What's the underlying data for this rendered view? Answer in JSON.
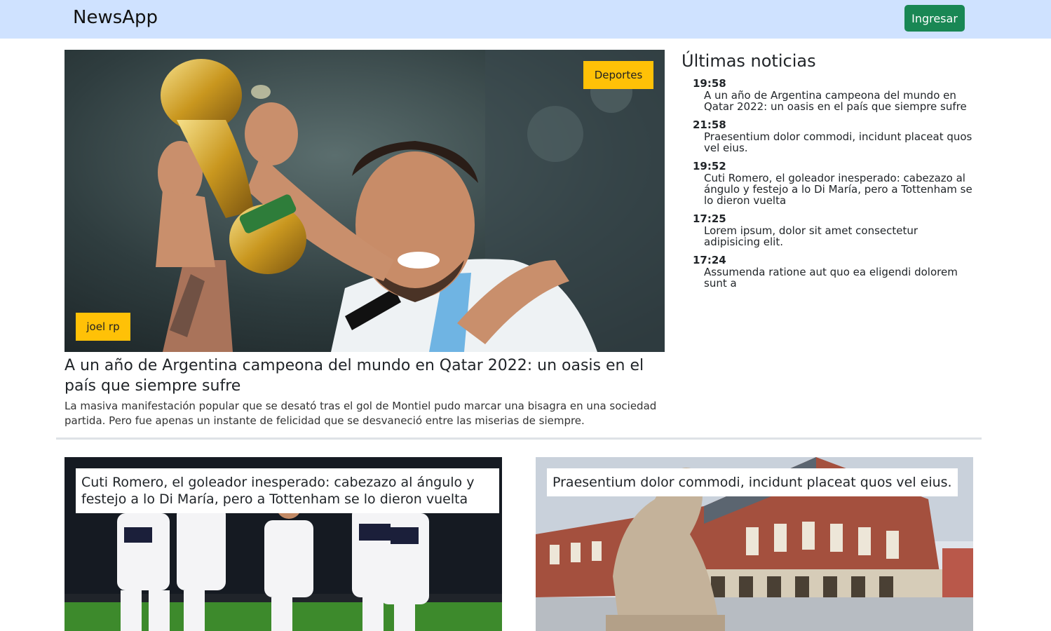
{
  "navbar": {
    "brand": "NewsApp",
    "login_label": "Ingresar",
    "background": "#cfe2ff",
    "login_color": "#198754"
  },
  "hero": {
    "category": "Deportes",
    "author": "joel rp",
    "title": "A un año de Argentina campeona del mundo en Qatar 2022: un oasis en el país que siempre sufre",
    "summary": "La masiva manifestación popular que se desató tras el gol de Montiel pudo marcar una bisagra en una sociedad partida. Pero fue apenas un instante de felicidad que se desvaneció entre las miserias de siempre.",
    "badge_color": "#ffc107"
  },
  "latest": {
    "heading": "Últimas noticias",
    "items": [
      {
        "time": "19:58",
        "title": "A un año de Argentina campeona del mundo en Qatar 2022: un oasis en el país que siempre sufre"
      },
      {
        "time": "21:58",
        "title": "Praesentium dolor commodi, incidunt placeat quos vel eius."
      },
      {
        "time": "19:52",
        "title": "Cuti Romero, el goleador inesperado: cabezazo al ángulo y festejo a lo Di María, pero a Tottenham se lo dieron vuelta"
      },
      {
        "time": "17:25",
        "title": "Lorem ipsum, dolor sit amet consectetur adipisicing elit."
      },
      {
        "time": "17:24",
        "title": "Assumenda ratione aut quo ea eligendi dolorem sunt a"
      }
    ]
  },
  "cards": [
    {
      "title": "Cuti Romero, el goleador inesperado: cabezazo al ángulo y festejo a lo Di María, pero a Tottenham se lo dieron vuelta"
    },
    {
      "title": "Praesentium dolor commodi, incidunt placeat quos vel eius."
    }
  ]
}
